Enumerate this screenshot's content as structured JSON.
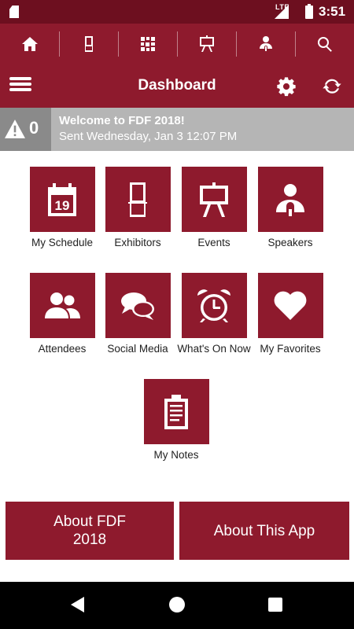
{
  "status_bar": {
    "network": "LTE",
    "battery": "",
    "time": "3:51"
  },
  "icon_bar": {
    "items": [
      {
        "name": "home-icon"
      },
      {
        "name": "exhibitor-booth-icon"
      },
      {
        "name": "qr-code-icon"
      },
      {
        "name": "easel-icon"
      },
      {
        "name": "speaker-icon"
      },
      {
        "name": "search-icon"
      }
    ]
  },
  "header": {
    "title": "Dashboard",
    "menu_icon": "hamburger-menu-icon",
    "settings_icon": "gear-icon",
    "refresh_icon": "refresh-icon"
  },
  "notification": {
    "count": "0",
    "title": "Welcome to FDF 2018!",
    "subtitle": "Sent Wednesday, Jan 3 12:07 PM"
  },
  "tiles": [
    {
      "label": "My Schedule",
      "icon": "calendar-icon",
      "calendar_day": "19"
    },
    {
      "label": "Exhibitors",
      "icon": "booth-icon"
    },
    {
      "label": "Events",
      "icon": "easel-icon"
    },
    {
      "label": "Speakers",
      "icon": "speaker-icon"
    },
    {
      "label": "Attendees",
      "icon": "people-icon"
    },
    {
      "label": "Social Media",
      "icon": "chat-bubbles-icon"
    },
    {
      "label": "What's On Now",
      "icon": "alarm-clock-icon"
    },
    {
      "label": "My Favorites",
      "icon": "heart-icon"
    },
    {
      "label": "My Notes",
      "icon": "clipboard-icon"
    }
  ],
  "buttons": {
    "about_fdf": "About FDF 2018",
    "about_app": "About This App"
  },
  "colors": {
    "primary": "#8e1a2d",
    "status_bar": "#6d0f1f",
    "notice_bg": "#b5b5b5",
    "notice_badge": "#8a8a8a"
  }
}
